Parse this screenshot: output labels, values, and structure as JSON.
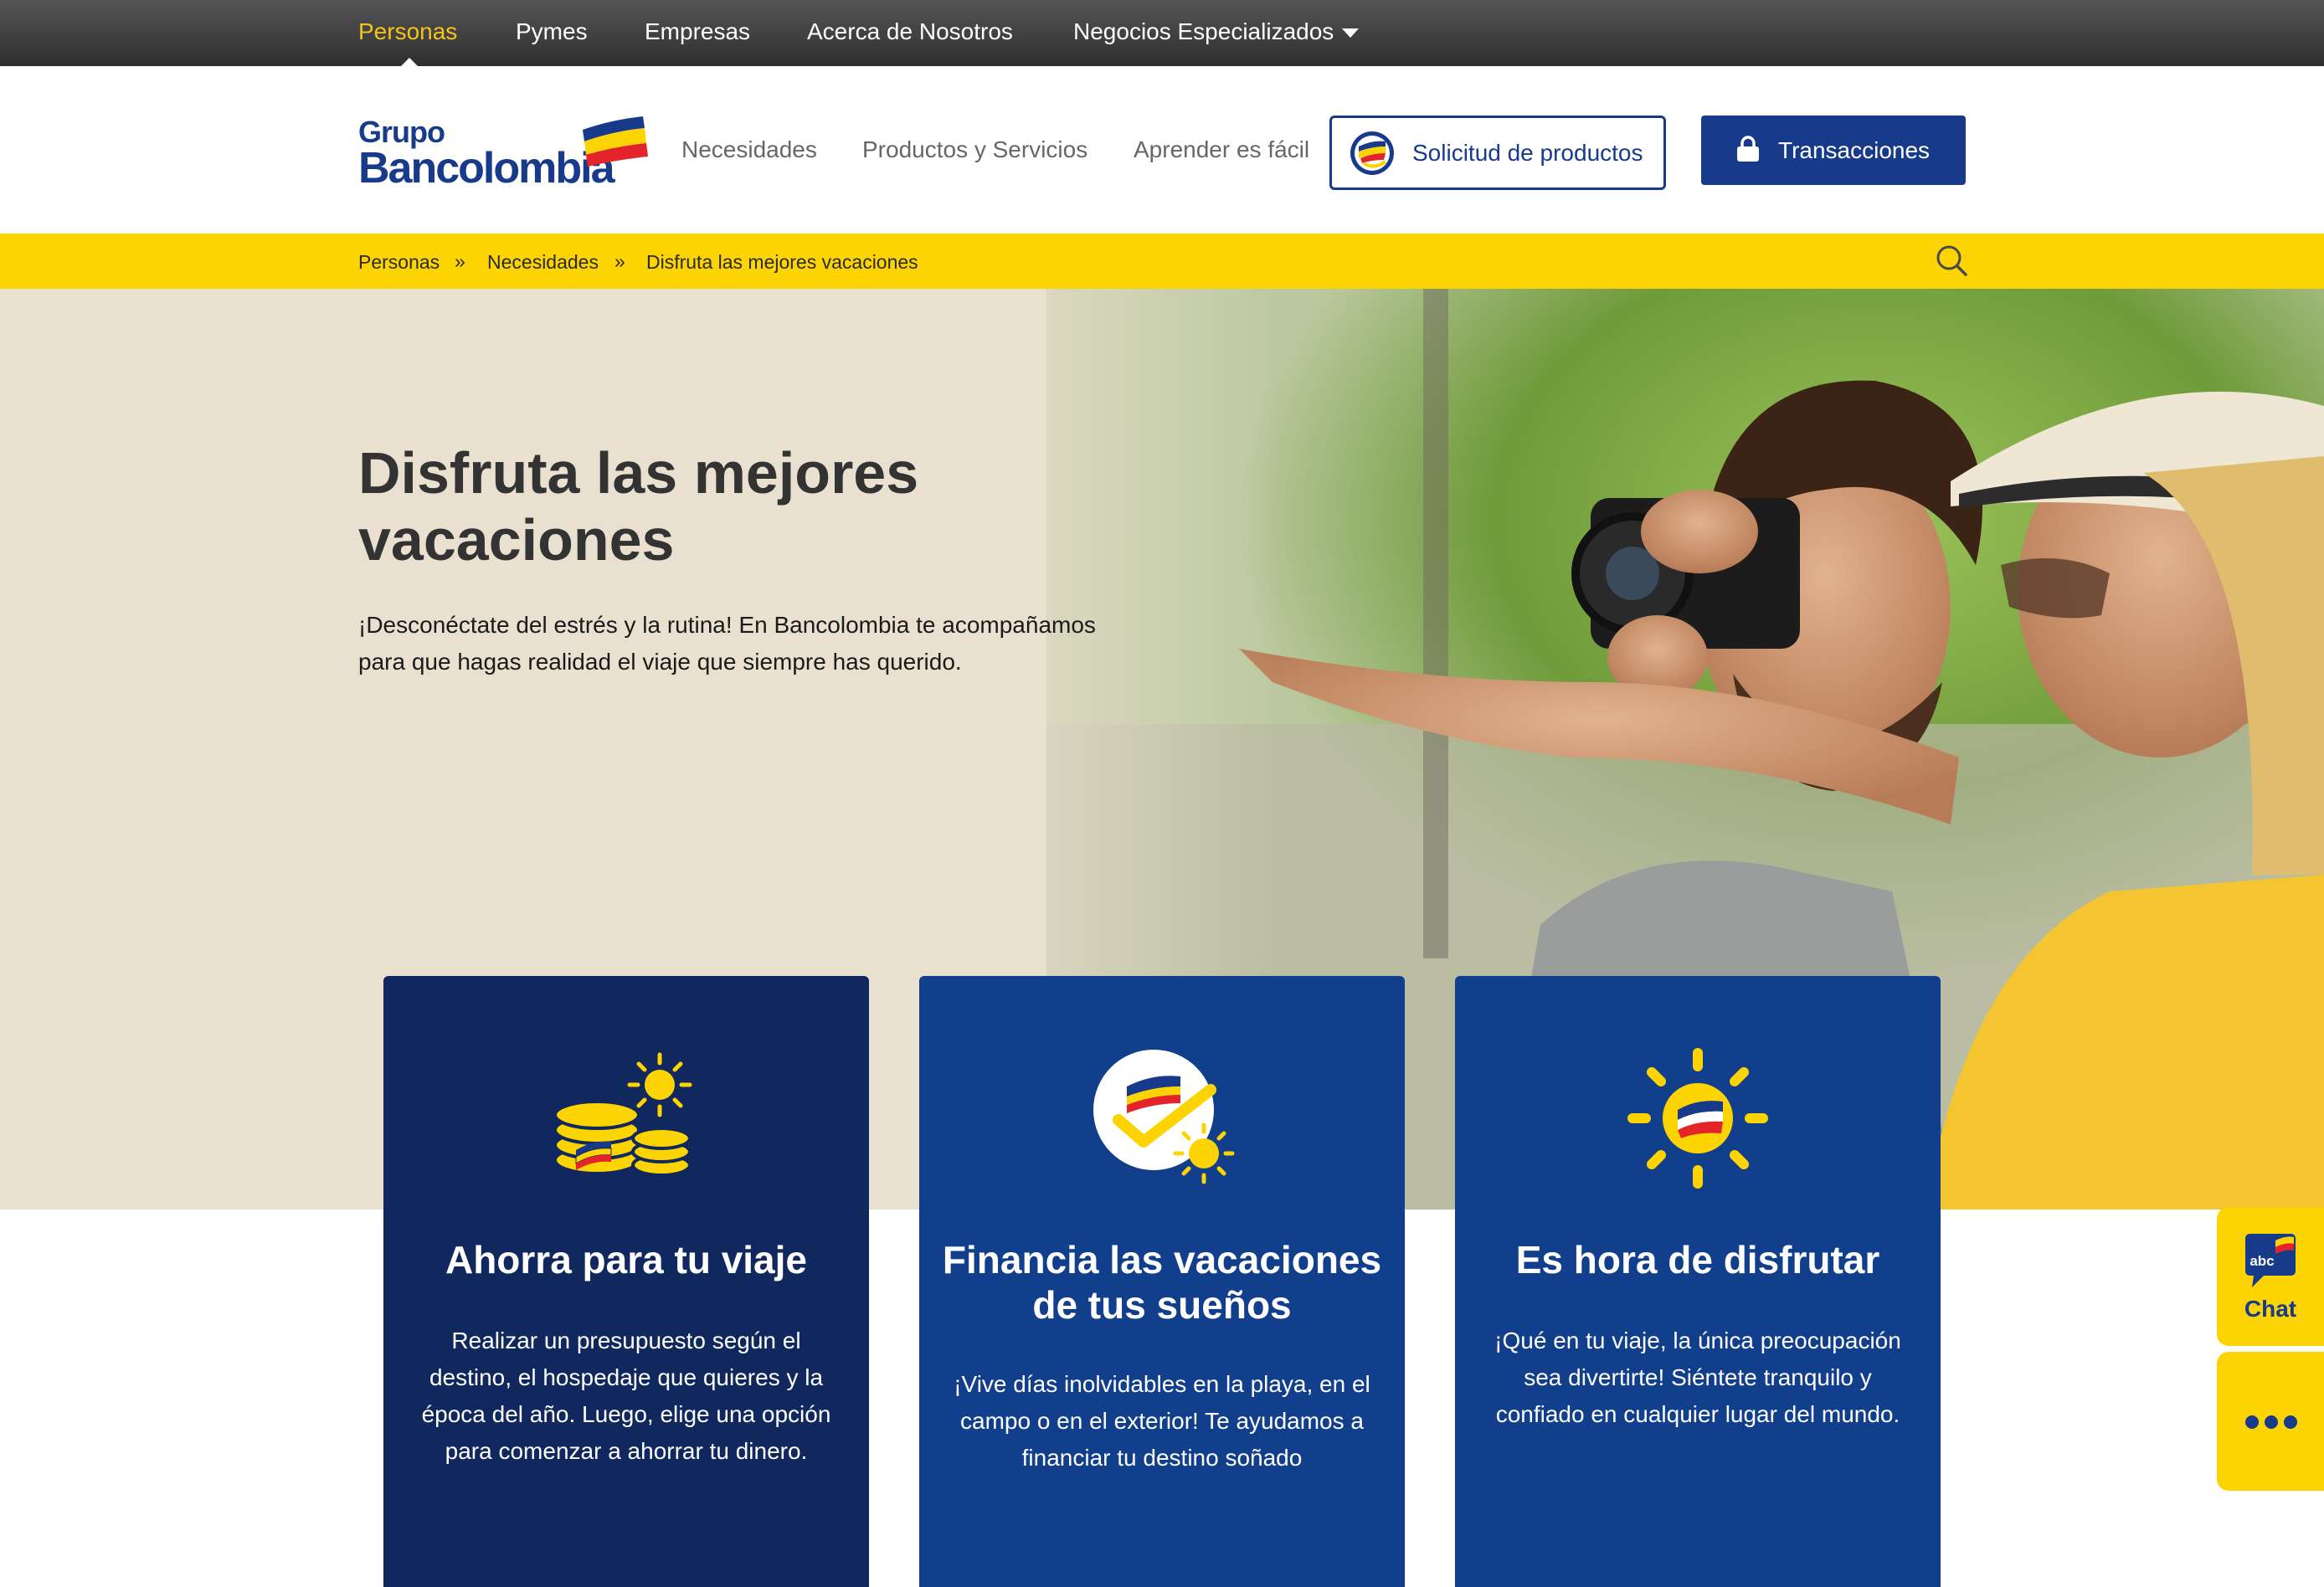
{
  "topnav": {
    "items": [
      {
        "label": "Personas",
        "active": true
      },
      {
        "label": "Pymes"
      },
      {
        "label": "Empresas"
      },
      {
        "label": "Acerca de Nosotros"
      },
      {
        "label": "Negocios Especializados",
        "has_dropdown": true
      }
    ]
  },
  "header": {
    "logo": {
      "line1": "Grupo",
      "line2": "Bancolombia"
    },
    "nav": [
      "Necesidades",
      "Productos y Servicios",
      "Aprender es fácil"
    ],
    "solicitud_label": "Solicitud de productos",
    "transacciones_label": "Transacciones"
  },
  "breadcrumb": {
    "items": [
      "Personas",
      "Necesidades",
      "Disfruta las mejores vacaciones"
    ],
    "separator": "»"
  },
  "hero": {
    "title": "Disfruta las mejores vacaciones",
    "text": "¡Desconéctate del estrés y la rutina!  En Bancolombia te acompañamos para que hagas realidad el viaje que siempre has querido."
  },
  "cards": [
    {
      "icon": "coins-sun-icon",
      "title": "Ahorra para tu viaje",
      "text": "Realizar un presupuesto según el destino, el hospedaje que quieres y la época del año. Luego, elige una opción para comenzar a ahorrar tu dinero."
    },
    {
      "icon": "check-sun-icon",
      "title": "Financia las vacaciones de tus sueños",
      "text": "¡Vive días inolvidables en la playa, en el campo o en el exterior!  Te ayudamos a financiar tu destino soñado"
    },
    {
      "icon": "sun-icon",
      "title": "Es hora de disfrutar",
      "text": "¡Qué en tu viaje, la única preocupación sea divertirte! Siéntete tranquilo y confiado en cualquier lugar del mundo."
    }
  ],
  "widgets": {
    "chat_badge": "abc",
    "chat_label": "Chat",
    "more": "more-icon"
  },
  "colors": {
    "brand_blue": "#173a8a",
    "brand_yellow": "#fdd403",
    "card_dark": "#10285e",
    "card_blue": "#123f8c",
    "active_nav": "#f7c31a"
  }
}
